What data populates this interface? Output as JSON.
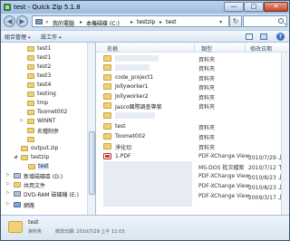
{
  "window": {
    "title": "test - Quick Zip 5.1.8",
    "minimize": "—",
    "maximize": "□",
    "close": "✕"
  },
  "address": {
    "sep": "«",
    "crumbs": [
      "我的電腦",
      "本機磁碟 (C:)",
      "testzip",
      "test"
    ],
    "crumb_sep": "▸",
    "dropdown": "▾",
    "refresh": "↻"
  },
  "toolbar": {
    "organize_label": "組合管理",
    "tools_label": "設工作",
    "caret": "▾",
    "help": "?"
  },
  "nav_tree": [
    {
      "label": "test1",
      "kind": "folder",
      "selected": false
    },
    {
      "label": "test1",
      "kind": "folder",
      "selected": false
    },
    {
      "label": "test2",
      "kind": "folder",
      "selected": false
    },
    {
      "label": "test3",
      "kind": "folder",
      "selected": false
    },
    {
      "label": "test4",
      "kind": "folder",
      "selected": false
    },
    {
      "label": "testing",
      "kind": "folder",
      "selected": false
    },
    {
      "label": "tmp",
      "kind": "folder",
      "selected": false
    },
    {
      "label": "Toomet002",
      "kind": "folder",
      "selected": false
    },
    {
      "label": "WINNT",
      "kind": "folder",
      "selected": false
    },
    {
      "label": "名種制參",
      "kind": "folder",
      "selected": false
    },
    {
      "label": "",
      "kind": "folder",
      "selected": false
    },
    {
      "label": "output.zip",
      "kind": "folder",
      "selected": false
    },
    {
      "label": "testzip",
      "kind": "folder",
      "selected": false
    },
    {
      "label": "test",
      "kind": "folder",
      "selected": true
    },
    {
      "label": "新增磁碟區 (D:)",
      "kind": "drive",
      "selected": false
    },
    {
      "label": "共用文件",
      "kind": "folder",
      "selected": false
    },
    {
      "label": "DVD-RAM 磁碟機 (E:)",
      "kind": "drive",
      "selected": false
    },
    {
      "label": "網路",
      "kind": "net",
      "selected": false
    }
  ],
  "columns": {
    "name": "名稱",
    "type": "類型",
    "date": "修改日期"
  },
  "files": [
    {
      "name": "",
      "type": "資料夾",
      "date": "",
      "icon": "folder"
    },
    {
      "name": "",
      "type": "資料夾",
      "date": "",
      "icon": "folder"
    },
    {
      "name": "code_project1",
      "type": "資料夾",
      "date": "",
      "icon": "folder"
    },
    {
      "name": "Jollyworker1",
      "type": "資料夾",
      "date": "",
      "icon": "folder"
    },
    {
      "name": "Jollyworker2",
      "type": "資料夾",
      "date": "",
      "icon": "folder"
    },
    {
      "name": "Jasco國際調查專案",
      "type": "資料夾",
      "date": "",
      "icon": "folder"
    },
    {
      "name": "",
      "type": "",
      "date": "",
      "icon": "folder"
    },
    {
      "name": "test",
      "type": "資料夾",
      "date": "",
      "icon": "folder"
    },
    {
      "name": "Toomet002",
      "type": "資料夾",
      "date": "",
      "icon": "folder"
    },
    {
      "name": "淨化切",
      "type": "資料夾",
      "date": "",
      "icon": "folder"
    },
    {
      "name": "1.PDF",
      "type": "PDF-XChange View",
      "date": "2010/7/29 上午",
      "icon": "pdf"
    },
    {
      "name": "",
      "type": "MS-DOS 批次檔案",
      "date": "2010/7/12 下午",
      "icon": "none"
    },
    {
      "name": "",
      "type": "PDF-XChange View",
      "date": "2010/8/23 上午",
      "icon": "none"
    },
    {
      "name": "",
      "type": "PDF-XChange View",
      "date": "2010/8/23 上午",
      "icon": "none"
    },
    {
      "name": "",
      "type": "PDF-XChange View",
      "date": "2009/3/17 上午",
      "icon": "none"
    }
  ],
  "details": {
    "name": "test",
    "type": "資料夾",
    "date": "修改日期: 2010/7/29 上午 11:03"
  }
}
